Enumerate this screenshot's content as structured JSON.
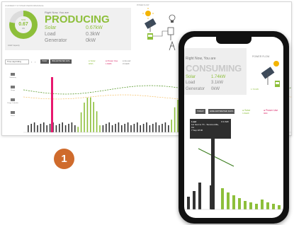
{
  "desktop": {
    "heading": "CURRENT SYSTEM PERFORMANCE",
    "donut": {
      "label": "NOW",
      "value": "0.67",
      "unit": "kW",
      "fraction": 0.78
    },
    "capacity": "10kW Capacity",
    "right_now": "Right Now, You are",
    "state": "PRODUCING",
    "rows": [
      {
        "label": "Solar",
        "value": "0.67kW"
      },
      {
        "label": "Load",
        "value": "0.3kW"
      },
      {
        "label": "Generator",
        "value": "0kW"
      }
    ],
    "flow_title": "POWER FLOW",
    "controls": {
      "period": "Three days/rolling",
      "today": "TODAY",
      "hide_estimated": "HIDE ESTIMATED DATA"
    },
    "legend": {
      "solar": {
        "label": "Solar",
        "value": "4kWh"
      },
      "power_use": {
        "label": "Power Use",
        "value": "1.3kWh"
      },
      "load": {
        "label": "ELoad",
        "value": "15.9kWh"
      }
    },
    "sidebar": [
      "Summary",
      "Usage",
      "Usage Calendar",
      "Status"
    ],
    "colors": {
      "accent": "#8dbf3a",
      "power_use": "#d81b60",
      "load": "#f3b44a"
    }
  },
  "step": {
    "number": "1"
  },
  "phone": {
    "right_now": "Right Now, You are",
    "state": "CONSUMING",
    "rows": [
      {
        "label": "Solar",
        "value": "1.74kW"
      },
      {
        "label": "Load",
        "value": "3.1kW"
      },
      {
        "label": "Generator",
        "value": "0kW"
      }
    ],
    "flow_title": "POWER FLOW",
    "flow_value": "1.74 kW",
    "controls": {
      "today": "TODAY",
      "hide_estimated": "HIDE ESTIMATED DATA"
    },
    "legend": {
      "solar": {
        "label": "Solar",
        "value": "3.35kWh"
      },
      "power_use": {
        "label": "Power Use",
        "value": "3840"
      }
    },
    "tooltip": {
      "title": "Load",
      "value": "0.3 kWh",
      "line1": "1st hour to 7C - Summerville,",
      "line2": "CA",
      "line3": "7 Sep 18:00"
    }
  }
}
